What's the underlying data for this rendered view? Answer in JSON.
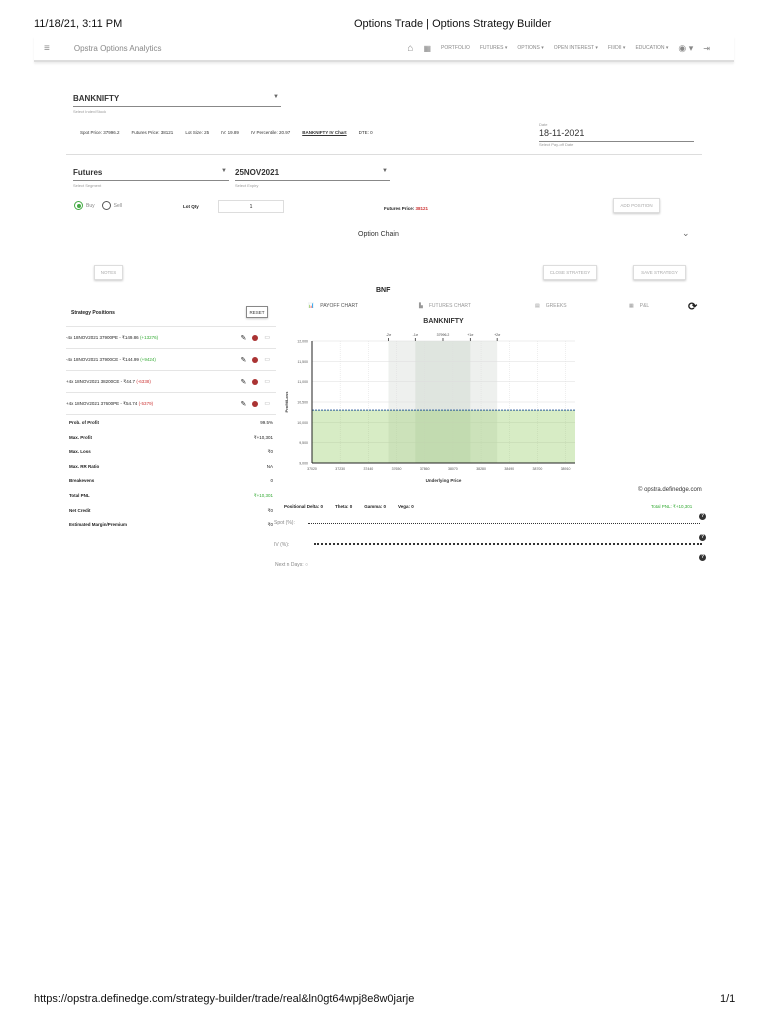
{
  "print_header": {
    "datetime": "11/18/21, 3:11 PM",
    "title": "Options Trade | Options Strategy Builder"
  },
  "print_footer": {
    "url": "https://opstra.definedge.com/strategy-builder/trade/real&ln0gt64wpj8e8w0jarje",
    "page": "1/1"
  },
  "nav": {
    "brand": "Opstra Options Analytics",
    "items": [
      "PORTFOLIO",
      "FUTURES",
      "OPTIONS",
      "OPEN INTEREST",
      "FII/DII",
      "EDUCATION"
    ]
  },
  "index": {
    "value": "BANKNIFTY",
    "label": "Select Index/Stock"
  },
  "info": {
    "spot": "Spot Price: 37996.2",
    "futures": "Futures Price: 38121",
    "lot": "Lot Size: 25",
    "iv": "IV: 19.89",
    "ivp": "IV Percentile: 20.97",
    "ivchart": "BANKNIFTY IV Chart",
    "dte": "DTE: 0"
  },
  "date": {
    "label": "Date",
    "value": "18-11-2021",
    "hint": "Select Pay-off Date"
  },
  "segment": {
    "value": "Futures",
    "label": "Select Segment"
  },
  "expiry": {
    "value": "25NOV2021",
    "label": "Select Expiry"
  },
  "buy": "Buy",
  "sell": "Sell",
  "lot_qty_label": "Lot Qty",
  "lot_qty": "1",
  "fut_price_label": "Futures Price: ",
  "fut_price": "38121",
  "add_position": "ADD POSITION",
  "option_chain": "Option Chain",
  "notes": "NOTES",
  "close_strategy": "CLOSE STRATEGY",
  "save_strategy": "SAVE STRATEGY",
  "bnf": "BNF",
  "strategy_positions": "Strategy Positions",
  "reset": "RESET",
  "positions": [
    {
      "text": "-4x 18NOV2021 37900PE - ₹149.86",
      "pnl": "(+13276)",
      "color": "g"
    },
    {
      "text": "-4x 18NOV2021 37900CE - ₹144.99",
      "pnl": "(+9424)",
      "color": "g"
    },
    {
      "text": "+4x 18NOV2021 38200CE - ₹44.7",
      "pnl": "(-6338)",
      "color": "r"
    },
    {
      "text": "+4x 18NOV2021 37600PE - ₹54.74",
      "pnl": "(-5379)",
      "color": "r"
    }
  ],
  "stats": [
    {
      "label": "Prob. of Profit",
      "value": "99.5%"
    },
    {
      "label": "Max. Profit",
      "value": "₹+10,301"
    },
    {
      "label": "Max. Loss",
      "value": "₹0"
    },
    {
      "label": "Max. RR Ratio",
      "value": "NA"
    },
    {
      "label": "Breakevens",
      "value": "0"
    },
    {
      "label": "Total PNL",
      "value": "₹+10,301",
      "color": "g"
    },
    {
      "label": "Net Credit",
      "value": "₹0"
    },
    {
      "label": "Estimated Margin/Premium",
      "value": "₹0"
    }
  ],
  "tabs": [
    "PAYOFF CHART",
    "FUTURES CHART",
    "GREEKS",
    "P&L"
  ],
  "chart_data": {
    "type": "area",
    "title": "BANKNIFTY",
    "xlabel": "Underlying Price",
    "ylabel": "Profit/Loss",
    "x_ticks": [
      37020,
      37230,
      37440,
      37650,
      37860,
      38070,
      38280,
      38490,
      38700,
      38910
    ],
    "y_ticks": [
      "9,000",
      "9,500",
      "10,000",
      "10,500",
      "11,000",
      "11,500",
      "12,000"
    ],
    "xlim": [
      37020,
      38980
    ],
    "ylim": [
      9000,
      12000
    ],
    "series": [
      {
        "name": "Payoff",
        "x": [
          37020,
          38980
        ],
        "y": [
          10301,
          10301
        ]
      }
    ],
    "sd_markers": [
      {
        "label": "-2σ",
        "x": 37590
      },
      {
        "label": "-1σ",
        "x": 37790
      },
      {
        "label": "37996.2",
        "x": 37996.2
      },
      {
        "label": "+1σ",
        "x": 38200
      },
      {
        "label": "+2σ",
        "x": 38400
      }
    ]
  },
  "copyright": "© opstra.definedge.com",
  "greeks": {
    "delta": "Positional Delta: 0",
    "theta": "Theta: 0",
    "gamma": "Gamma: 0",
    "vega": "Vega: 0"
  },
  "total_pnl": "Total PNL: ₹+10,301",
  "spot_label": "Spot (%):",
  "iv_label": "IV (%):",
  "days_label": "Next n Days:",
  "slider_zero": "0"
}
